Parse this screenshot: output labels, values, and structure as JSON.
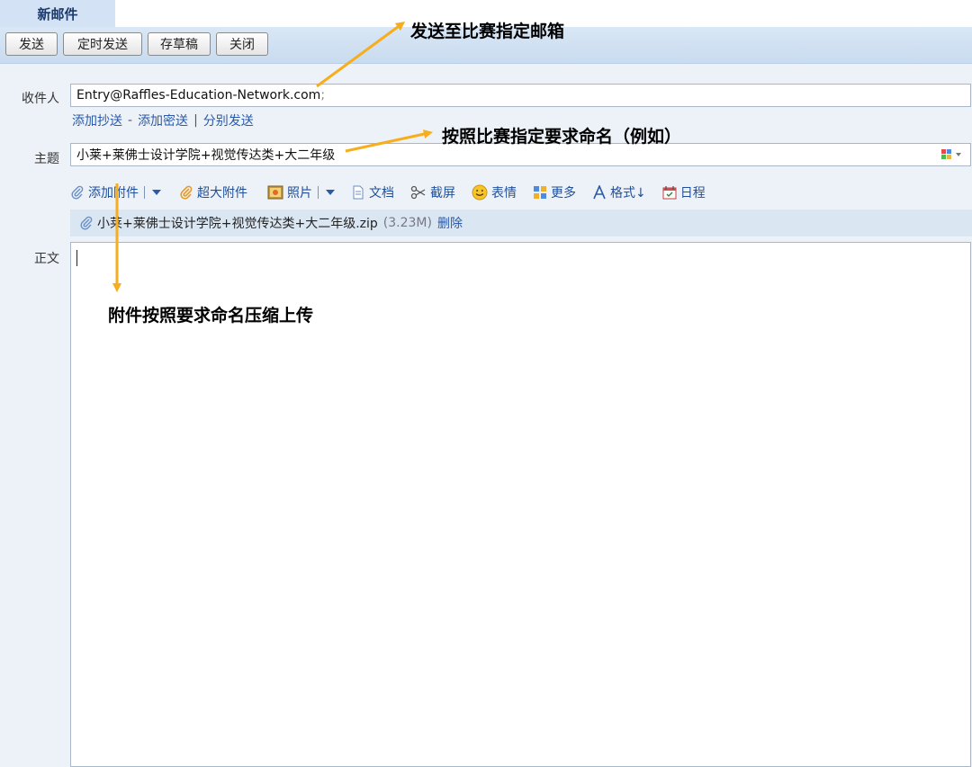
{
  "tab": {
    "title": "新邮件"
  },
  "toolbar": {
    "send": "发送",
    "scheduled_send": "定时发送",
    "save_draft": "存草稿",
    "close": "关闭"
  },
  "compose": {
    "to_label": "收件人",
    "to_value": "Entry@Raffles-Education-Network.com",
    "to_suffix": ";",
    "add_cc": "添加抄送",
    "dash": "-",
    "add_bcc": "添加密送",
    "pipe": "|",
    "separate_send": "分别发送",
    "subject_label": "主题",
    "subject_value": "小莱+莱佛士设计学院+视觉传达类+大二年级",
    "body_label": "正文"
  },
  "attach_toolbar": {
    "add_attachment": "添加附件",
    "large_attachment": "超大附件",
    "photo": "照片",
    "document": "文档",
    "screenshot": "截屏",
    "emoji": "表情",
    "more": "更多",
    "format": "格式↓",
    "calendar": "日程"
  },
  "attachment": {
    "filename": "小莱+莱佛士设计学院+视觉传达类+大二年级.zip",
    "size": "(3.23M)",
    "delete": "删除"
  },
  "annotations": {
    "send_to": "发送至比赛指定邮箱",
    "naming": "按照比赛指定要求命名（例如）",
    "attach_note": "附件按照要求命名压缩上传"
  },
  "colors": {
    "arrow": "#f7ae1c",
    "link": "#2a5aa8",
    "tab": "#d3e3f5"
  }
}
